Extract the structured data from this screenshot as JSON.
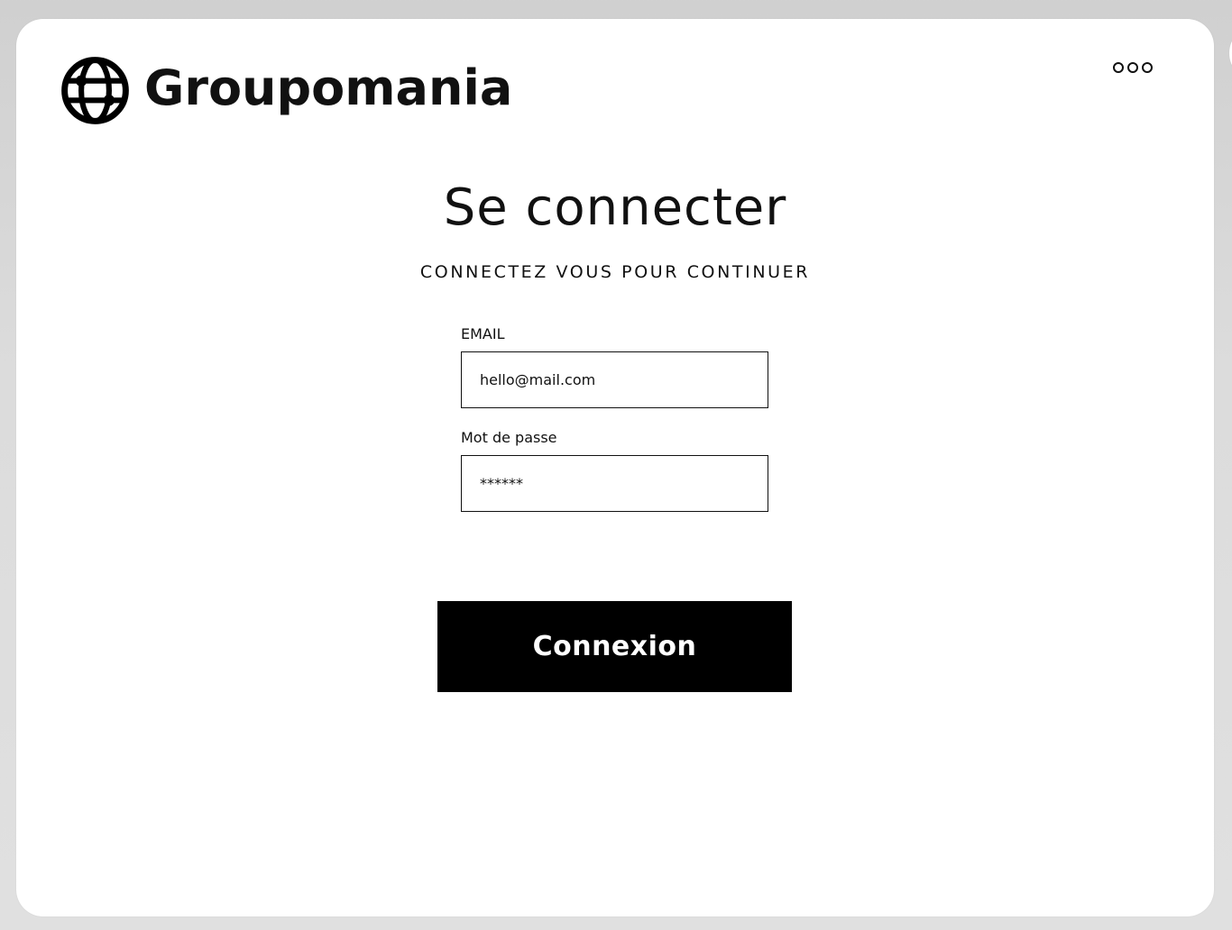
{
  "brand": {
    "name": "Groupomania",
    "logo_icon": "globe-icon"
  },
  "header": {
    "menu_icon": "more-options-icon"
  },
  "login": {
    "title": "Se connecter",
    "subtitle": "CONNECTEZ VOUS POUR CONTINUER",
    "email": {
      "label": "EMAIL",
      "value": "hello@mail.com"
    },
    "password": {
      "label": "Mot de passe",
      "value": "******"
    },
    "submit_label": "Connexion"
  },
  "colors": {
    "primary": "#000000",
    "background": "#ffffff",
    "page_backdrop": "#d9d9d9"
  }
}
